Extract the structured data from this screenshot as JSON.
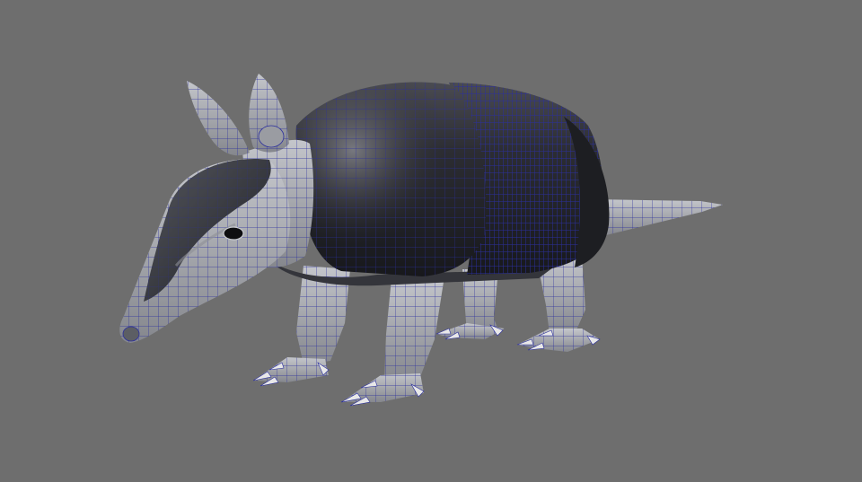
{
  "viewport": {
    "background_color": "#6e6e6e",
    "model": {
      "subject": "armadillo",
      "display_mode": "shaded-with-wireframe",
      "wireframe_color": "#2b2f9e",
      "shell_color": "#2a2b30",
      "skin_color": "#a9abb0",
      "claw_color": "#e8e8e8"
    }
  }
}
